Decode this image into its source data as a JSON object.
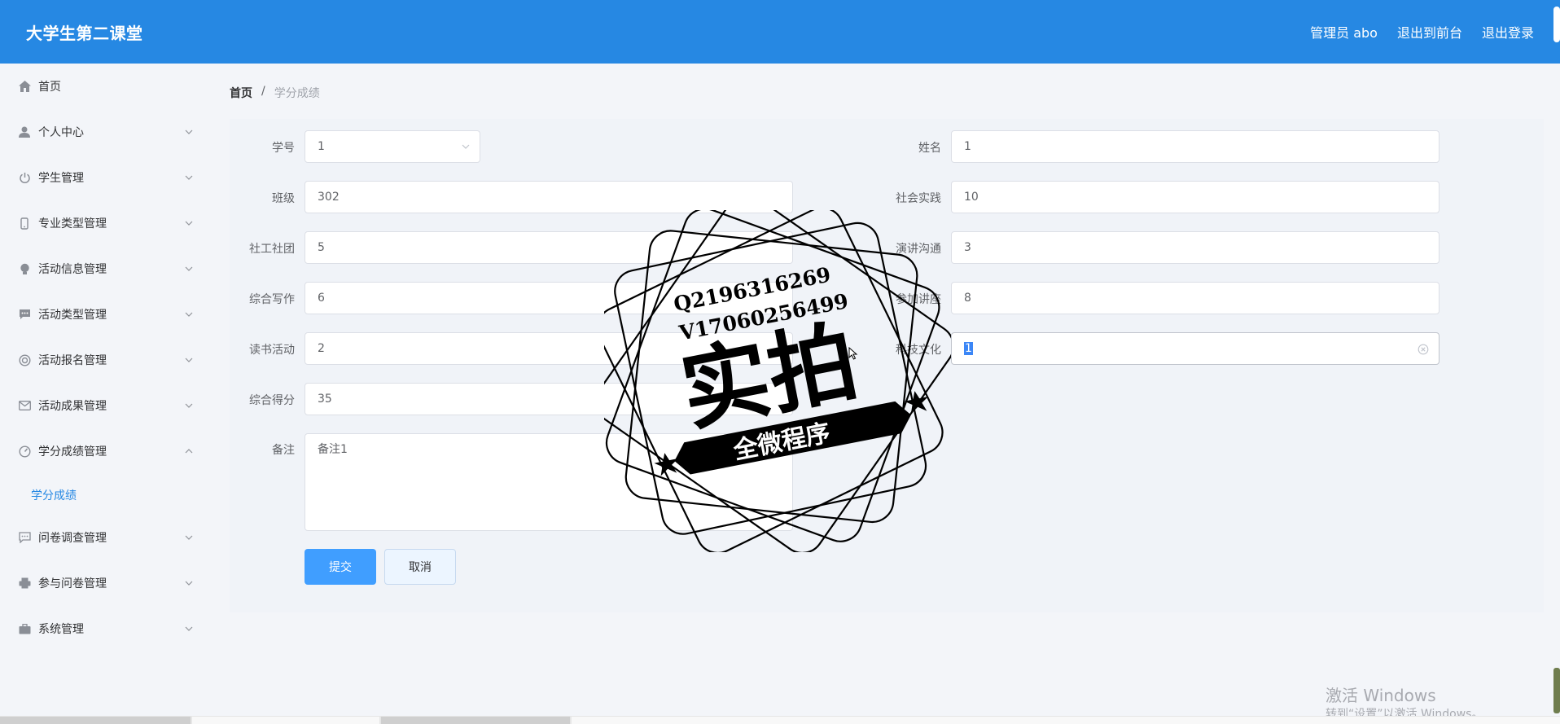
{
  "app": {
    "title": "大学生第二课堂",
    "header_links": [
      "管理员 abo",
      "退出到前台",
      "退出登录"
    ]
  },
  "sidebar": {
    "items": [
      {
        "label": "首页",
        "icon": "home-icon"
      },
      {
        "label": "个人中心",
        "icon": "user-icon"
      },
      {
        "label": "学生管理",
        "icon": "power-icon"
      },
      {
        "label": "专业类型管理",
        "icon": "mobile-icon"
      },
      {
        "label": "活动信息管理",
        "icon": "bulb-icon"
      },
      {
        "label": "活动类型管理",
        "icon": "chat-icon"
      },
      {
        "label": "活动报名管理",
        "icon": "lifebuoy-icon"
      },
      {
        "label": "活动成果管理",
        "icon": "mail-icon"
      },
      {
        "label": "学分成绩管理",
        "icon": "gauge-icon"
      },
      {
        "label": "问卷调查管理",
        "icon": "comment-icon"
      },
      {
        "label": "参与问卷管理",
        "icon": "printer-icon"
      },
      {
        "label": "系统管理",
        "icon": "briefcase-icon"
      }
    ],
    "submenu": {
      "label": "学分成绩"
    }
  },
  "breadcrumb": {
    "home": "首页",
    "separator": "/",
    "current": "学分成绩"
  },
  "form": {
    "student_id": {
      "label": "学号",
      "value": "1"
    },
    "name": {
      "label": "姓名",
      "value": "1"
    },
    "class": {
      "label": "班级",
      "value": "302"
    },
    "social_practice": {
      "label": "社会实践",
      "value": "10"
    },
    "club": {
      "label": "社工社团",
      "value": "5"
    },
    "speech": {
      "label": "演讲沟通",
      "value": "3"
    },
    "writing": {
      "label": "综合写作",
      "value": "6"
    },
    "lecture": {
      "label": "参加讲座",
      "value": "8"
    },
    "reading": {
      "label": "读书活动",
      "value": "2"
    },
    "tech_culture": {
      "label": "科技文化",
      "value": "1"
    },
    "total_score": {
      "label": "综合得分",
      "value": "35"
    },
    "remark": {
      "label": "备注",
      "value": "备注1"
    },
    "submit_label": "提交",
    "cancel_label": "取消"
  },
  "stamp": {
    "qq": "Q2196316269",
    "phone": "V17060256499",
    "main_text": "实拍",
    "ribbon_text": "全微程序"
  },
  "watermark": {
    "title": "激活 Windows",
    "subtitle": "转到“设置”以激活 Windows。"
  },
  "colors": {
    "header_bg": "#2688e3",
    "primary": "#409eff",
    "page_bg": "#f3f5f9",
    "card_bg": "#f0f3f8",
    "active_submenu": "#2688e3"
  }
}
